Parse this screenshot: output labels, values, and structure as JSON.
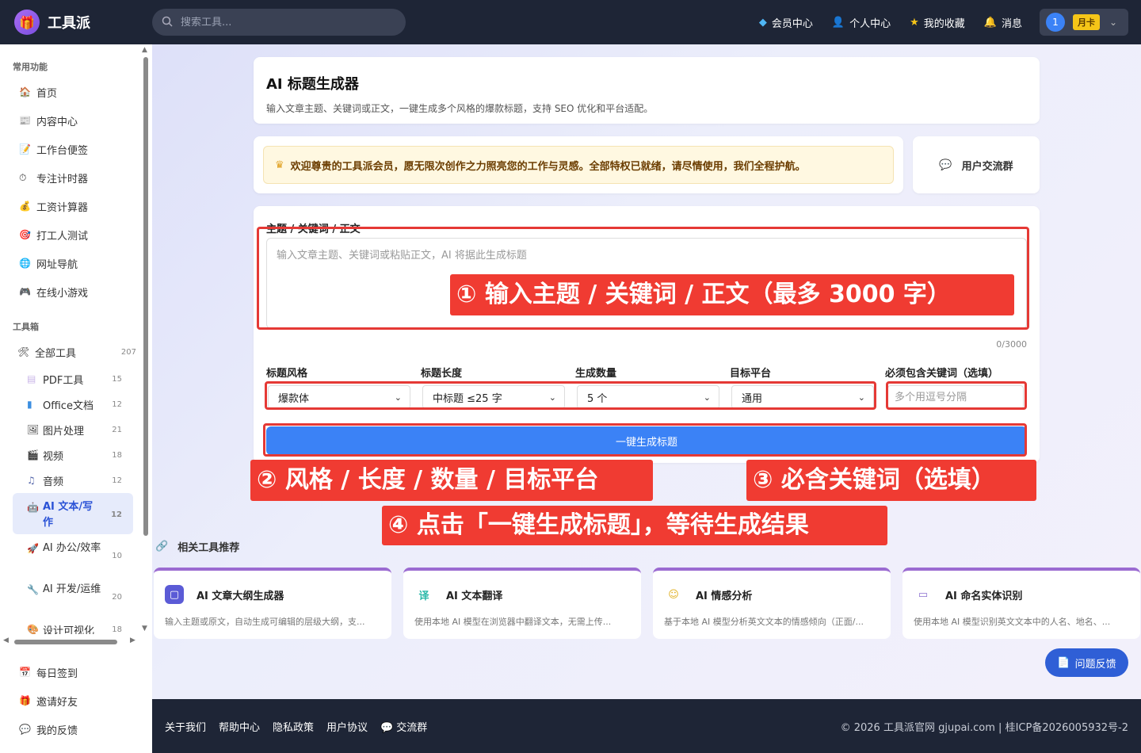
{
  "app": {
    "name": "工具派",
    "logo_icon": "gift-box-icon"
  },
  "search": {
    "placeholder": "搜索工具..."
  },
  "nav": {
    "items": [
      {
        "label": "会员中心",
        "icon": "diamond-icon"
      },
      {
        "label": "个人中心",
        "icon": "user-icon"
      },
      {
        "label": "我的收藏",
        "icon": "star-icon"
      },
      {
        "label": "消息",
        "icon": "bell-icon"
      }
    ],
    "user": {
      "avatar": "1",
      "badge": "月卡"
    }
  },
  "sidebar": {
    "common_title": "常用功能",
    "common_items": [
      {
        "label": "首页",
        "icon": "home-icon"
      },
      {
        "label": "内容中心",
        "icon": "newspaper-icon"
      },
      {
        "label": "工作台便签",
        "icon": "memo-icon"
      },
      {
        "label": "专注计时器",
        "icon": "stopwatch-icon"
      },
      {
        "label": "工资计算器",
        "icon": "money-bag-icon"
      },
      {
        "label": "打工人测试",
        "icon": "target-icon"
      },
      {
        "label": "网址导航",
        "icon": "globe-icon"
      },
      {
        "label": "在线小游戏",
        "icon": "gamepad-icon"
      }
    ],
    "toolbox_title": "工具箱",
    "all_tools": {
      "label": "全部工具",
      "count": "207"
    },
    "sub_items": [
      {
        "label": "PDF工具",
        "count": "15"
      },
      {
        "label": "Office文档",
        "count": "12"
      },
      {
        "label": "图片处理",
        "count": "21"
      },
      {
        "label": "视频",
        "count": "18"
      },
      {
        "label": "音频",
        "count": "12"
      },
      {
        "label": "AI 文本/写作",
        "count": "12"
      },
      {
        "label": "AI 办公/效率",
        "count": "10"
      },
      {
        "label": "AI 开发/运维",
        "count": "20"
      },
      {
        "label": "设计可视化",
        "count": "18"
      }
    ],
    "bottom_items": [
      {
        "label": "每日签到",
        "icon": "calendar-icon"
      },
      {
        "label": "邀请好友",
        "icon": "gift-icon"
      },
      {
        "label": "我的反馈",
        "icon": "speech-bubble-icon"
      }
    ]
  },
  "page": {
    "title": "AI 标题生成器",
    "subtitle": "输入文章主题、关键词或正文，一键生成多个风格的爆款标题，支持 SEO 优化和平台适配。"
  },
  "notice": {
    "text": "欢迎尊贵的工具派会员，愿无限次创作之力照亮您的工作与灵感。全部特权已就绪，请尽情使用，我们全程护航。"
  },
  "group": {
    "label": "用户交流群"
  },
  "form": {
    "topic_label": "主题 / 关键词 / 正文",
    "topic_placeholder": "输入文章主题、关键词或粘贴正文，AI 将据此生成标题",
    "counter": "0/3000",
    "style_label": "标题风格",
    "style_value": "爆款体",
    "length_label": "标题长度",
    "length_value": "中标题 ≤25 字",
    "count_label": "生成数量",
    "count_value": "5 个",
    "platform_label": "目标平台",
    "platform_value": "通用",
    "keyword_label": "必须包含关键词（选填）",
    "keyword_placeholder": "多个用逗号分隔",
    "submit_label": "一键生成标题"
  },
  "annotations": {
    "a1": "① 输入主题 / 关键词 / 正文（最多 3000 字）",
    "a2": "② 风格 / 长度 / 数量 / 目标平台",
    "a3": "③ 必含关键词（选填）",
    "a4": "④ 点击「一键生成标题」，等待生成结果"
  },
  "related": {
    "title": "相关工具推荐",
    "tools": [
      {
        "name": "AI 文章大纲生成器",
        "desc": "输入主题或原文，自动生成可编辑的层级大纲，支..."
      },
      {
        "name": "AI 文本翻译",
        "desc": "使用本地 AI 模型在浏览器中翻译文本，无需上传..."
      },
      {
        "name": "AI 情感分析",
        "desc": "基于本地 AI 模型分析英文文本的情感倾向（正面/..."
      },
      {
        "name": "AI 命名实体识别",
        "desc": "使用本地 AI 模型识别英文文本中的人名、地名、..."
      }
    ]
  },
  "feedback": {
    "label": "问题反馈"
  },
  "footer": {
    "links": [
      "关于我们",
      "帮助中心",
      "隐私政策",
      "用户协议",
      "交流群"
    ],
    "copyright": "© 2026 工具派官网 gjupai.com | 桂ICP备2026005932号-2"
  },
  "colors": {
    "primary": "#3b82f6",
    "topbar": "#1e2536",
    "annotation": "#f03b32",
    "badge": "#f5c518"
  }
}
